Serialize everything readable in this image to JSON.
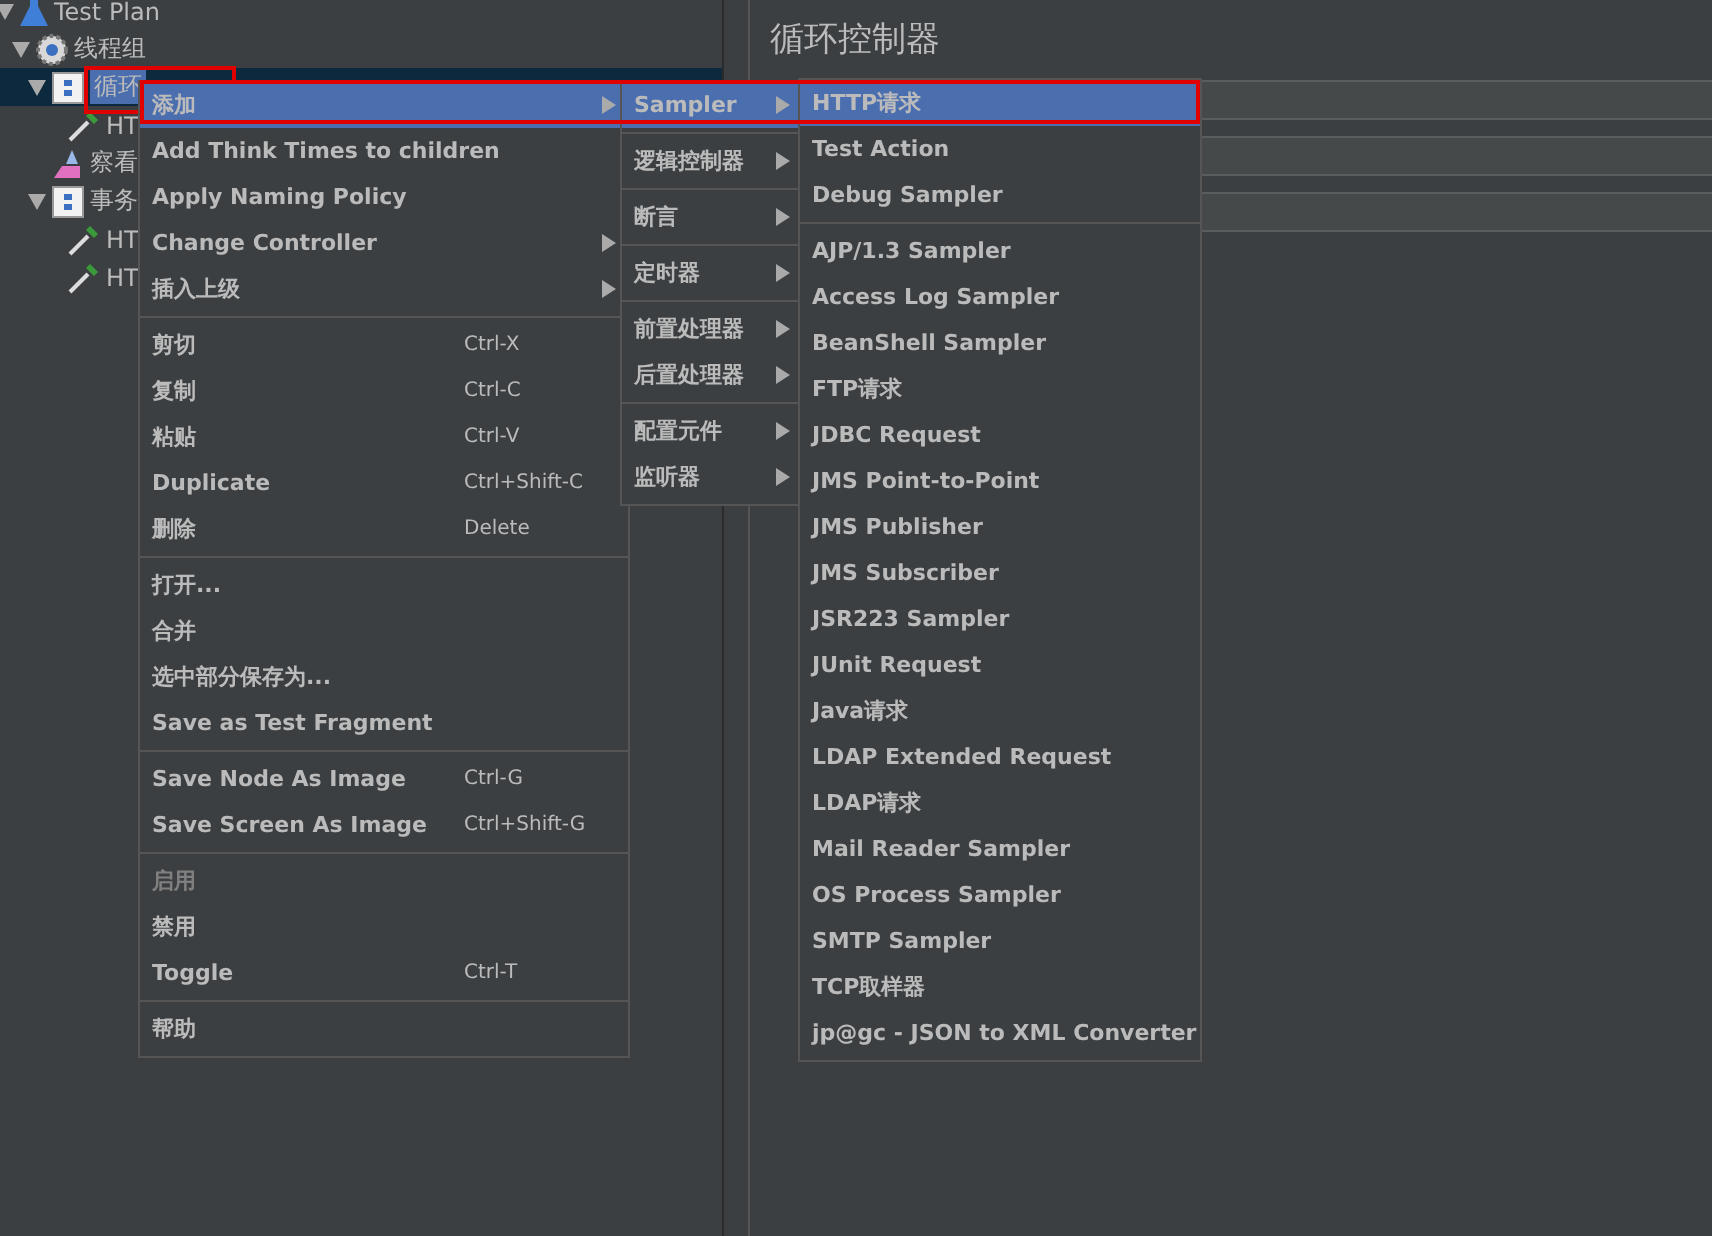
{
  "tree": [
    {
      "label": "Test Plan",
      "kind": "flask",
      "expanded": true,
      "selected": false,
      "children": [
        {
          "label": "线程组",
          "kind": "gear",
          "expanded": true,
          "selected": false,
          "children": [
            {
              "label": "循环",
              "kind": "controller",
              "expanded": true,
              "selected": true,
              "children": [
                {
                  "label": "HT",
                  "kind": "sampler",
                  "selected": false
                }
              ]
            },
            {
              "label": "察看",
              "kind": "listener",
              "selected": false
            },
            {
              "label": "事务",
              "kind": "controller",
              "expanded": true,
              "selected": false,
              "children": [
                {
                  "label": "HT",
                  "kind": "sampler",
                  "selected": false
                },
                {
                  "label": "HT",
                  "kind": "sampler",
                  "selected": false
                }
              ]
            }
          ]
        }
      ]
    }
  ],
  "panel": {
    "title": "循环控制器"
  },
  "context_menu": [
    {
      "kind": "item",
      "label": "添加",
      "submenu": true,
      "selected": true,
      "disabled": false
    },
    {
      "kind": "item",
      "label": "Add Think Times to children",
      "submenu": false,
      "selected": false,
      "disabled": false
    },
    {
      "kind": "item",
      "label": "Apply Naming Policy",
      "submenu": false,
      "selected": false,
      "disabled": false
    },
    {
      "kind": "item",
      "label": "Change Controller",
      "submenu": true,
      "selected": false,
      "disabled": false
    },
    {
      "kind": "item",
      "label": "插入上级",
      "submenu": true,
      "selected": false,
      "disabled": false
    },
    {
      "kind": "separator"
    },
    {
      "kind": "item",
      "label": "剪切",
      "shortcut": "Ctrl-X",
      "submenu": false,
      "selected": false,
      "disabled": false
    },
    {
      "kind": "item",
      "label": "复制",
      "shortcut": "Ctrl-C",
      "submenu": false,
      "selected": false,
      "disabled": false
    },
    {
      "kind": "item",
      "label": "粘贴",
      "shortcut": "Ctrl-V",
      "submenu": false,
      "selected": false,
      "disabled": false
    },
    {
      "kind": "item",
      "label": "Duplicate",
      "shortcut": "Ctrl+Shift-C",
      "submenu": false,
      "selected": false,
      "disabled": false
    },
    {
      "kind": "item",
      "label": "删除",
      "shortcut": "Delete",
      "submenu": false,
      "selected": false,
      "disabled": false
    },
    {
      "kind": "separator"
    },
    {
      "kind": "item",
      "label": "打开...",
      "submenu": false,
      "selected": false,
      "disabled": false
    },
    {
      "kind": "item",
      "label": "合并",
      "submenu": false,
      "selected": false,
      "disabled": false
    },
    {
      "kind": "item",
      "label": "选中部分保存为...",
      "submenu": false,
      "selected": false,
      "disabled": false
    },
    {
      "kind": "item",
      "label": "Save as Test Fragment",
      "submenu": false,
      "selected": false,
      "disabled": false
    },
    {
      "kind": "separator"
    },
    {
      "kind": "item",
      "label": "Save Node As Image",
      "shortcut": "Ctrl-G",
      "submenu": false,
      "selected": false,
      "disabled": false
    },
    {
      "kind": "item",
      "label": "Save Screen As Image",
      "shortcut": "Ctrl+Shift-G",
      "submenu": false,
      "selected": false,
      "disabled": false
    },
    {
      "kind": "separator"
    },
    {
      "kind": "item",
      "label": "启用",
      "submenu": false,
      "selected": false,
      "disabled": true
    },
    {
      "kind": "item",
      "label": "禁用",
      "submenu": false,
      "selected": false,
      "disabled": false
    },
    {
      "kind": "item",
      "label": "Toggle",
      "shortcut": "Ctrl-T",
      "submenu": false,
      "selected": false,
      "disabled": false
    },
    {
      "kind": "separator"
    },
    {
      "kind": "item",
      "label": "帮助",
      "submenu": false,
      "selected": false,
      "disabled": false
    }
  ],
  "add_submenu": [
    {
      "kind": "item",
      "label": "Sampler",
      "submenu": true,
      "selected": true
    },
    {
      "kind": "separator"
    },
    {
      "kind": "item",
      "label": "逻辑控制器",
      "submenu": true,
      "selected": false
    },
    {
      "kind": "separator"
    },
    {
      "kind": "item",
      "label": "断言",
      "submenu": true,
      "selected": false
    },
    {
      "kind": "separator"
    },
    {
      "kind": "item",
      "label": "定时器",
      "submenu": true,
      "selected": false
    },
    {
      "kind": "separator"
    },
    {
      "kind": "item",
      "label": "前置处理器",
      "submenu": true,
      "selected": false
    },
    {
      "kind": "item",
      "label": "后置处理器",
      "submenu": true,
      "selected": false
    },
    {
      "kind": "separator"
    },
    {
      "kind": "item",
      "label": "配置元件",
      "submenu": true,
      "selected": false
    },
    {
      "kind": "item",
      "label": "监听器",
      "submenu": true,
      "selected": false
    }
  ],
  "sampler_submenu": [
    {
      "kind": "item",
      "label": "HTTP请求",
      "selected": true
    },
    {
      "kind": "item",
      "label": "Test Action",
      "selected": false
    },
    {
      "kind": "item",
      "label": "Debug Sampler",
      "selected": false
    },
    {
      "kind": "separator"
    },
    {
      "kind": "item",
      "label": "AJP/1.3 Sampler",
      "selected": false
    },
    {
      "kind": "item",
      "label": "Access Log Sampler",
      "selected": false
    },
    {
      "kind": "item",
      "label": "BeanShell Sampler",
      "selected": false
    },
    {
      "kind": "item",
      "label": "FTP请求",
      "selected": false
    },
    {
      "kind": "item",
      "label": "JDBC Request",
      "selected": false
    },
    {
      "kind": "item",
      "label": "JMS Point-to-Point",
      "selected": false
    },
    {
      "kind": "item",
      "label": "JMS Publisher",
      "selected": false
    },
    {
      "kind": "item",
      "label": "JMS Subscriber",
      "selected": false
    },
    {
      "kind": "item",
      "label": "JSR223 Sampler",
      "selected": false
    },
    {
      "kind": "item",
      "label": "JUnit Request",
      "selected": false
    },
    {
      "kind": "item",
      "label": "Java请求",
      "selected": false
    },
    {
      "kind": "item",
      "label": "LDAP Extended Request",
      "selected": false
    },
    {
      "kind": "item",
      "label": "LDAP请求",
      "selected": false
    },
    {
      "kind": "item",
      "label": "Mail Reader Sampler",
      "selected": false
    },
    {
      "kind": "item",
      "label": "OS Process Sampler",
      "selected": false
    },
    {
      "kind": "item",
      "label": "SMTP Sampler",
      "selected": false
    },
    {
      "kind": "item",
      "label": "TCP取样器",
      "selected": false
    },
    {
      "kind": "item",
      "label": "jp@gc - JSON to XML Converter",
      "selected": false
    }
  ]
}
